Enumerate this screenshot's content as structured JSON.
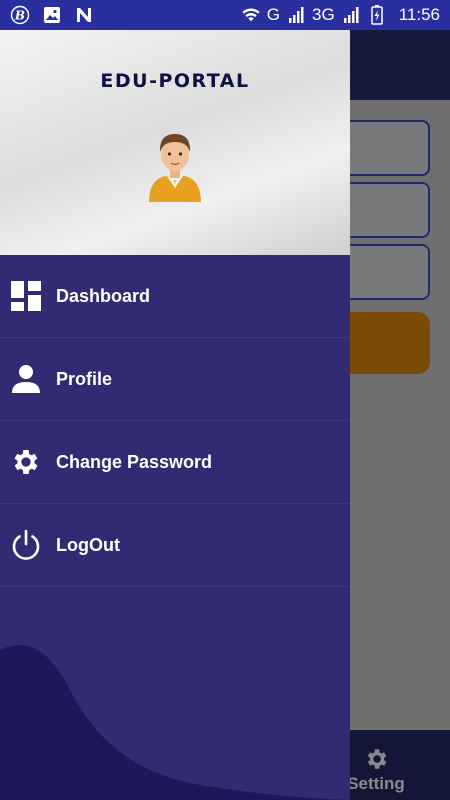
{
  "status_bar": {
    "network_g": "G",
    "network_3g": "3G",
    "time": "11:56",
    "icons": [
      "b-app-icon",
      "image-icon",
      "n-app-icon",
      "wifi-icon",
      "signal-icon",
      "signal-icon",
      "battery-icon"
    ]
  },
  "drawer": {
    "brand": "EDU-PORTAL",
    "menu": [
      {
        "label": "Dashboard",
        "icon": "dashboard-icon"
      },
      {
        "label": "Profile",
        "icon": "person-icon"
      },
      {
        "label": "Change Password",
        "icon": "gear-icon"
      },
      {
        "label": "LogOut",
        "icon": "power-icon"
      }
    ]
  },
  "background_app": {
    "bottom_nav_label": "Setting"
  },
  "colors": {
    "status_bar": "#2a2fa0",
    "drawer_bg": "#322a72",
    "drawer_wave": "#1e175a",
    "toolbar": "#161a3e",
    "accent_button": "#7a4a08"
  }
}
